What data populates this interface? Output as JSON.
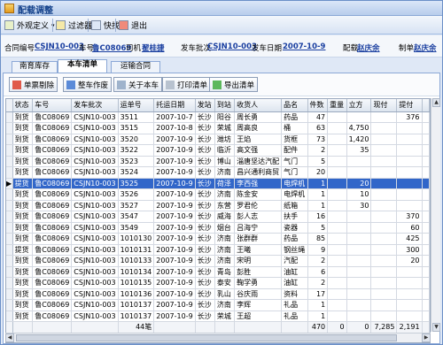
{
  "window": {
    "title": "配载调整"
  },
  "toolbar": {
    "items": [
      {
        "label": "外观定义"
      },
      {
        "label": "过滤器"
      },
      {
        "label": "快找"
      },
      {
        "label": "退出"
      }
    ]
  },
  "info": {
    "contract_label": "合同编号",
    "contract_value": "CSJN10-003",
    "vehicle_label": "车号",
    "vehicle_value": "鲁C08069",
    "driver_label": "司机",
    "driver_value": "翟桂捷",
    "batch_label": "发车批次",
    "batch_value": "CSJN10-003",
    "date_label": "发车日期",
    "date_value": "2007-10-9",
    "loader_label": "配载:",
    "loader_value": "赵庆余",
    "maker_label": "制单",
    "maker_value": "赵庆余"
  },
  "tabs": [
    {
      "label": "南育库存"
    },
    {
      "label": "本车清单"
    },
    {
      "label": "运输合同"
    }
  ],
  "actions": [
    {
      "label": "单票剔除"
    },
    {
      "label": "整车作废"
    },
    {
      "label": "关于本车"
    },
    {
      "label": "打印清单"
    },
    {
      "label": "导出清单"
    }
  ],
  "grid": {
    "columns": [
      "状态",
      "车号",
      "发车批次",
      "运单号",
      "托运日期",
      "发站",
      "到站",
      "收货人",
      "品名",
      "件数",
      "重量",
      "立方",
      "现付",
      "提付",
      ""
    ],
    "rows": [
      [
        "到货",
        "鲁C08069",
        "CSJN10-003",
        "3511",
        "2007-10-7",
        "长沙",
        "阳谷",
        "周长勇",
        "药品",
        "47",
        "",
        "",
        "",
        "376"
      ],
      [
        "到货",
        "鲁C08069",
        "CSJN10-003",
        "3515",
        "2007-10-8",
        "长沙",
        "荣城",
        "周高良",
        "桶",
        "63",
        "",
        "4,750",
        "",
        ""
      ],
      [
        "到货",
        "鲁C08069",
        "CSJN10-003",
        "3520",
        "2007-10-9",
        "长沙",
        "潍坊",
        "王焰",
        "货框",
        "73",
        "",
        "1,420",
        "",
        ""
      ],
      [
        "到货",
        "鲁C08069",
        "CSJN10-003",
        "3522",
        "2007-10-9",
        "长沙",
        "临沂",
        "高文强",
        "配件",
        "2",
        "",
        "35",
        "",
        ""
      ],
      [
        "到货",
        "鲁C08069",
        "CSJN10-003",
        "3523",
        "2007-10-9",
        "长沙",
        "博山",
        "淄唐坚达汽配",
        "气门",
        "5",
        "",
        "",
        "",
        ""
      ],
      [
        "到货",
        "鲁C08069",
        "CSJN10-003",
        "3524",
        "2007-10-9",
        "长沙",
        "济南",
        "昌兴通利商贸",
        "气门",
        "20",
        "",
        "",
        "",
        ""
      ],
      [
        "提货",
        "鲁C08069",
        "CSJN10-003",
        "3525",
        "2007-10-9",
        "长沙",
        "荷泽",
        "李西强",
        "电焊机",
        "1",
        "",
        "20",
        "",
        ""
      ],
      [
        "到货",
        "鲁C08069",
        "CSJN10-003",
        "3526",
        "2007-10-9",
        "长沙",
        "济南",
        "陈金安",
        "电焊机",
        "1",
        "",
        "10",
        "",
        ""
      ],
      [
        "到货",
        "鲁C08069",
        "CSJN10-003",
        "3527",
        "2007-10-9",
        "长沙",
        "东营",
        "罗君伦",
        "纸箱",
        "1",
        "",
        "30",
        "",
        ""
      ],
      [
        "到货",
        "鲁C08069",
        "CSJN10-003",
        "3547",
        "2007-10-9",
        "长沙",
        "威海",
        "彭人志",
        "扶手",
        "16",
        "",
        "",
        "",
        "370"
      ],
      [
        "到货",
        "鲁C08069",
        "CSJN10-003",
        "3549",
        "2007-10-9",
        "长沙",
        "烟台",
        "吕海宁",
        "瓷器",
        "5",
        "",
        "",
        "",
        "60"
      ],
      [
        "到货",
        "鲁C08069",
        "CSJN10-003",
        "1010130",
        "2007-10-9",
        "长沙",
        "济南",
        "张群群",
        "药品",
        "85",
        "",
        "",
        "",
        "425"
      ],
      [
        "提货",
        "鲁C08069",
        "CSJN10-003",
        "1010131",
        "2007-10-9",
        "长沙",
        "济南",
        "王曦",
        "钢丝绳",
        "9",
        "",
        "",
        "",
        "300"
      ],
      [
        "到货",
        "鲁C08069",
        "CSJN10-003",
        "1010133",
        "2007-10-9",
        "长沙",
        "济南",
        "宋明",
        "汽配",
        "2",
        "",
        "",
        "",
        "20"
      ],
      [
        "到货",
        "鲁C08069",
        "CSJN10-003",
        "1010134",
        "2007-10-9",
        "长沙",
        "青岛",
        "彭胜",
        "油缸",
        "6",
        "",
        "",
        "",
        ""
      ],
      [
        "到货",
        "鲁C08069",
        "CSJN10-003",
        "1010135",
        "2007-10-9",
        "长沙",
        "泰安",
        "鞠学勇",
        "油缸",
        "2",
        "",
        "",
        "",
        ""
      ],
      [
        "到货",
        "鲁C08069",
        "CSJN10-003",
        "1010136",
        "2007-10-9",
        "长沙",
        "乳山",
        "谷庆雨",
        "资料",
        "17",
        "",
        "",
        "",
        ""
      ],
      [
        "到货",
        "鲁C08069",
        "CSJN10-003",
        "1010137",
        "2007-10-9",
        "长沙",
        "济南",
        "李辉",
        "礼品",
        "1",
        "",
        "",
        "",
        ""
      ],
      [
        "到货",
        "鲁C08069",
        "CSJN10-003",
        "1010137",
        "2007-10-9",
        "长沙",
        "荣城",
        "王超",
        "礼品",
        "1",
        "",
        "",
        "",
        ""
      ]
    ],
    "selected_row": 6,
    "totals": {
      "count": "44笔",
      "pieces": "470",
      "weight": "0",
      "volume": "0",
      "cash": "7,285",
      "collect": "2,191"
    }
  },
  "colors": {
    "selected": "#3166c9",
    "link": "#1a3fa0"
  }
}
